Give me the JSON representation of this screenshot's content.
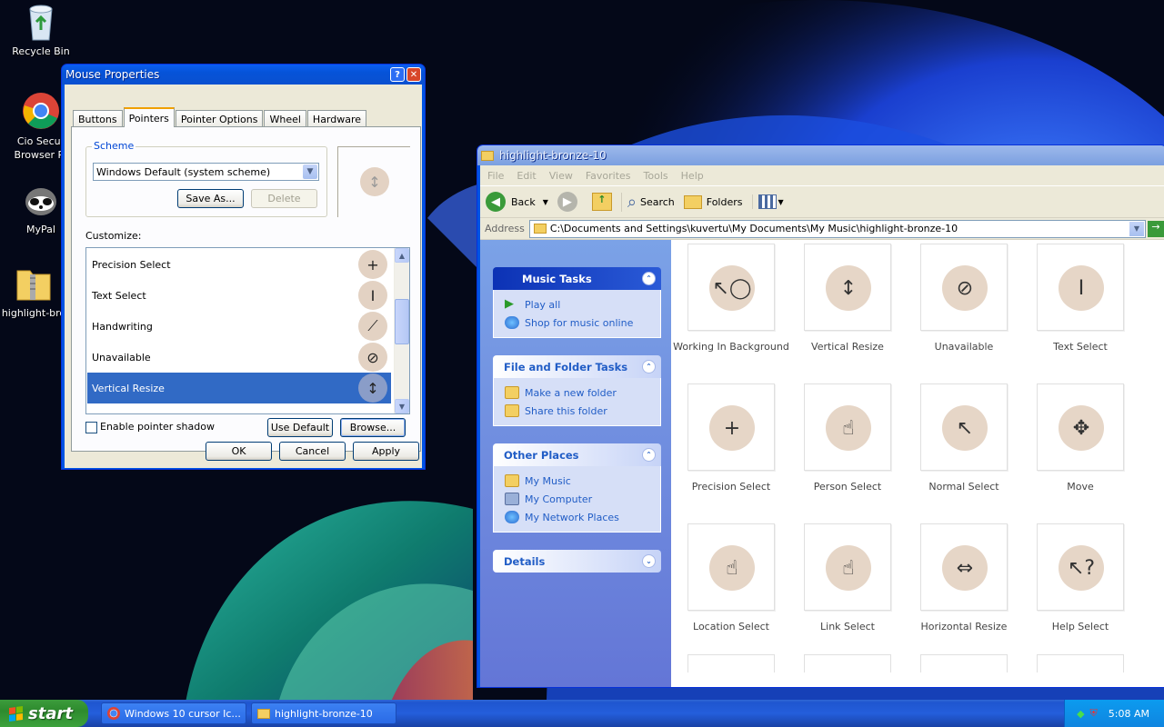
{
  "desktop": {
    "icons": [
      {
        "label": "Recycle Bin"
      },
      {
        "label": "Cio Secur\nBrowser Pr"
      },
      {
        "label": "MyPal"
      },
      {
        "label": "highlight-bro"
      }
    ]
  },
  "mouse_dialog": {
    "title": "Mouse Properties",
    "help_btn": "?",
    "close_btn": "✕",
    "tabs": [
      "Buttons",
      "Pointers",
      "Pointer Options",
      "Wheel",
      "Hardware"
    ],
    "selected_tab": "Pointers",
    "scheme": {
      "group_label": "Scheme",
      "value": "Windows Default (system scheme)",
      "save_as": "Save As...",
      "delete": "Delete"
    },
    "customize_label": "Customize:",
    "pointers": [
      {
        "name": "Precision Select",
        "glyph": "+"
      },
      {
        "name": "Text Select",
        "glyph": "I"
      },
      {
        "name": "Handwriting",
        "glyph": "⟋"
      },
      {
        "name": "Unavailable",
        "glyph": "⊘"
      },
      {
        "name": "Vertical Resize",
        "glyph": "↕"
      }
    ],
    "selected_pointer": "Vertical Resize",
    "preview_glyph": "↕",
    "shadow_label": "Enable pointer shadow",
    "use_default": "Use Default",
    "browse": "Browse...",
    "ok": "OK",
    "cancel": "Cancel",
    "apply": "Apply"
  },
  "explorer": {
    "title": "highlight-bronze-10",
    "menu": [
      "File",
      "Edit",
      "View",
      "Favorites",
      "Tools",
      "Help"
    ],
    "toolbar": {
      "back": "Back",
      "search": "Search",
      "folders": "Folders"
    },
    "address_label": "Address",
    "address": "C:\\Documents and Settings\\kuvertu\\My Documents\\My Music\\highlight-bronze-10",
    "music_tasks": {
      "title": "Music Tasks",
      "items": [
        "Play all",
        "Shop for music online"
      ]
    },
    "file_tasks": {
      "title": "File and Folder Tasks",
      "items": [
        "Make a new folder",
        "Share this folder"
      ]
    },
    "other_places": {
      "title": "Other Places",
      "items": [
        "My Music",
        "My Computer",
        "My Network Places"
      ]
    },
    "details": {
      "title": "Details"
    },
    "files": [
      {
        "name": "Working In Background",
        "glyph": "↖◯"
      },
      {
        "name": "Vertical Resize",
        "glyph": "↕"
      },
      {
        "name": "Unavailable",
        "glyph": "⊘"
      },
      {
        "name": "Text Select",
        "glyph": "I"
      },
      {
        "name": "Precision Select",
        "glyph": "+"
      },
      {
        "name": "Person Select",
        "glyph": "☝"
      },
      {
        "name": "Normal Select",
        "glyph": "↖"
      },
      {
        "name": "Move",
        "glyph": "✥"
      },
      {
        "name": "Location Select",
        "glyph": "☝"
      },
      {
        "name": "Link Select",
        "glyph": "☝"
      },
      {
        "name": "Horizontal Resize",
        "glyph": "⇔"
      },
      {
        "name": "Help Select",
        "glyph": "↖?"
      }
    ]
  },
  "taskbar": {
    "start": "start",
    "buttons": [
      "Windows 10 cursor Ic...",
      "highlight-bronze-10"
    ],
    "clock": "5:08 AM"
  }
}
